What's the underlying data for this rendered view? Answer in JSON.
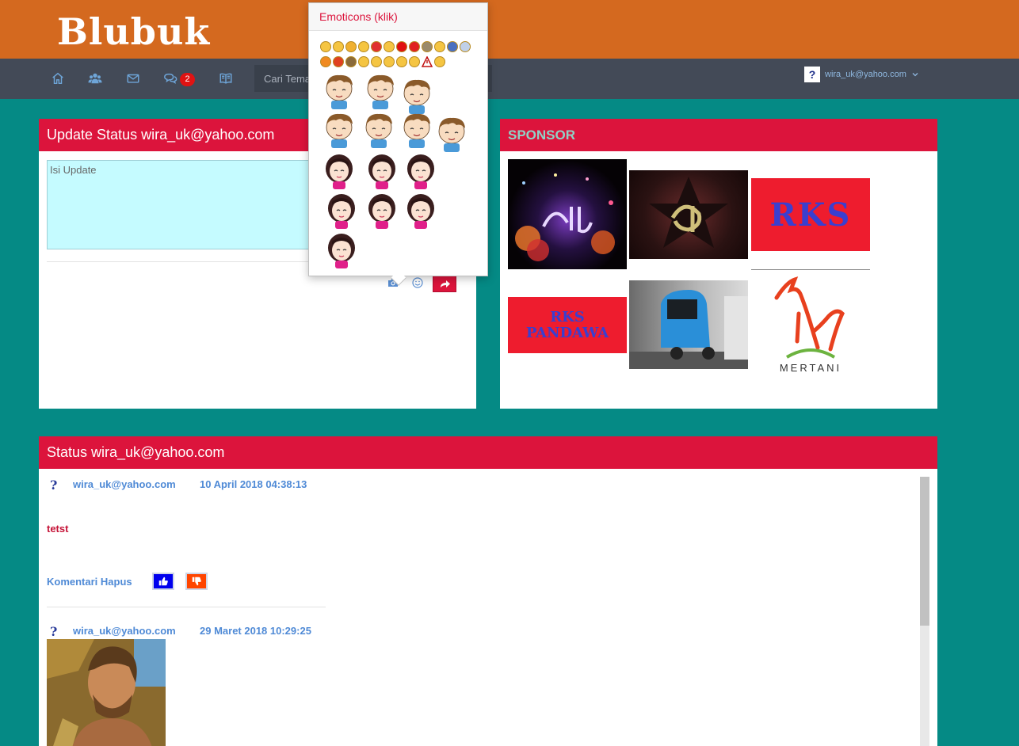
{
  "app": {
    "logo": "Blubuk"
  },
  "nav": {
    "items": [
      {
        "name": "home",
        "icon": "home-icon"
      },
      {
        "name": "friends",
        "icon": "users-icon"
      },
      {
        "name": "messages",
        "icon": "envelope-icon"
      },
      {
        "name": "chat",
        "icon": "comments-icon",
        "badge": "2"
      },
      {
        "name": "guestbook",
        "icon": "book-icon"
      }
    ],
    "search_placeholder": "Cari Teman",
    "user_email": "wira_uk@yahoo.com"
  },
  "update_panel": {
    "title": "Update Status wira_uk@yahoo.com",
    "textarea_placeholder": "Isi Update",
    "tools": [
      "camera-icon",
      "smiley-icon",
      "share-icon"
    ]
  },
  "emoticon_popover": {
    "title": "Emoticons (klik)"
  },
  "sponsor_panel": {
    "title": "SPONSOR",
    "banners": [
      {
        "alt": "calligraphy-1"
      },
      {
        "alt": "calligraphy-2"
      },
      {
        "text": "RKS",
        "color": "#ee1c2e",
        "text_color": "#3a3fcf"
      },
      {
        "text": "RKS PANDAWA",
        "color": "#ee1c2e",
        "text_color": "#3a3fcf"
      },
      {
        "alt": "bajaj"
      },
      {
        "text": "MERTANI",
        "color": "#ffffff",
        "text_color": "#333333"
      }
    ]
  },
  "status_panel": {
    "title": "Status wira_uk@yahoo.com",
    "posts": [
      {
        "user": "wira_uk@yahoo.com",
        "date": "10 April 2018 04:38:13",
        "text": "tetst",
        "actions": "Komentari Hapus"
      },
      {
        "user": "wira_uk@yahoo.com",
        "date": "29 Maret 2018 10:29:25"
      }
    ]
  },
  "colors": {
    "header": "#d4691f",
    "navbar": "#434a57",
    "background": "#058a85",
    "panel_header": "#dc143c",
    "link": "#4f8ad6",
    "like": "#0000ee",
    "dislike": "#ff4500"
  }
}
